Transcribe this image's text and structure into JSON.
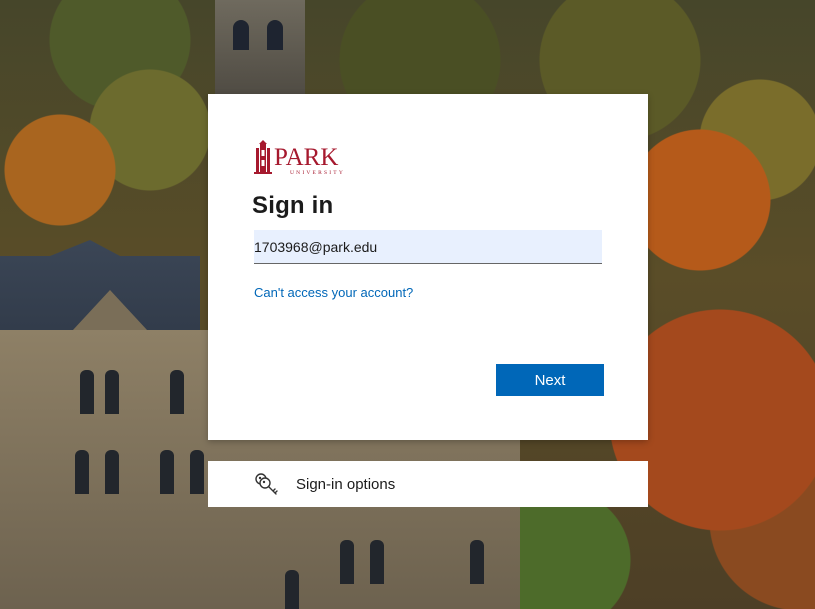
{
  "brand": {
    "name": "PARK",
    "sub": "UNIVERSITY",
    "color": "#a6192e"
  },
  "signin": {
    "title": "Sign in",
    "email_value": "1703968@park.edu",
    "cant_access_link": "Can't access your account?",
    "next_label": "Next"
  },
  "options": {
    "label": "Sign-in options",
    "icon": "key-icon"
  },
  "colors": {
    "accent": "#0067b8",
    "input_bg": "#e8f0fe"
  }
}
